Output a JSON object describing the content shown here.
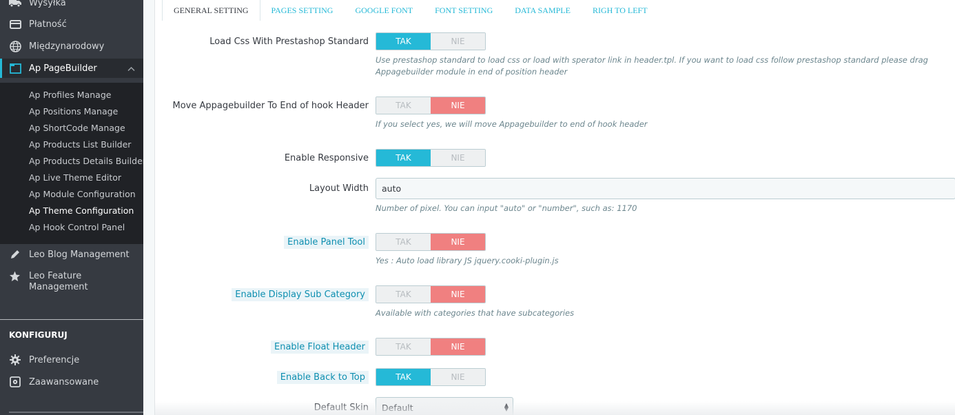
{
  "sidebar": {
    "top_items": [
      {
        "label": "Wysyłka",
        "icon": "truck-icon"
      },
      {
        "label": "Płatność",
        "icon": "credit-card-icon"
      },
      {
        "label": "Międzynarodowy",
        "icon": "globe-icon"
      }
    ],
    "active_item": {
      "label": "Ap PageBuilder",
      "icon": "browser-window-icon"
    },
    "sub_items": [
      {
        "label": "Ap Profiles Manage"
      },
      {
        "label": "Ap Positions Manage"
      },
      {
        "label": "Ap ShortCode Manage"
      },
      {
        "label": "Ap Products List Builder"
      },
      {
        "label": "Ap Products Details Builder"
      },
      {
        "label": "Ap Live Theme Editor"
      },
      {
        "label": "Ap Module Configuration"
      },
      {
        "label": "Ap Theme Configuration"
      },
      {
        "label": "Ap Hook Control Panel"
      }
    ],
    "leo_blog": {
      "label": "Leo Blog Management",
      "icon": "pencil-icon"
    },
    "leo_feature": {
      "line1": "Leo Feature",
      "line2": "Management",
      "icon": "star-icon"
    },
    "section_title": "KONFIGURUJ",
    "config_items": [
      {
        "label": "Preferencje",
        "icon": "gear-icon"
      },
      {
        "label": "Zaawansowane",
        "icon": "advanced-settings-icon"
      }
    ]
  },
  "tabs": [
    {
      "label": "GENERAL SETTING",
      "active": true
    },
    {
      "label": "PAGES SETTING"
    },
    {
      "label": "GOOGLE FONT"
    },
    {
      "label": "FONT SETTING"
    },
    {
      "label": "DATA SAMPLE"
    },
    {
      "label": "RIGH TO LEFT"
    }
  ],
  "switch_labels": {
    "yes": "TAK",
    "no": "NIE"
  },
  "form": {
    "load_css": {
      "label": "Load Css With Prestashop Standard",
      "value": "TAK",
      "help": "Use prestashop standard to load css or load with sperator link in header.tpl. If you want to load css follow prestashop standard please drag Appagebuilder module in end of position header"
    },
    "move_header": {
      "label": "Move Appagebuilder To End of hook Header",
      "value": "NIE",
      "help": "If you select yes, we will move Appagebuilder to end of hook header"
    },
    "responsive": {
      "label": "Enable Responsive",
      "value": "TAK"
    },
    "layout_width": {
      "label": "Layout Width",
      "value": "auto",
      "help": "Number of pixel. You can input \"auto\" or \"number\", such as: 1170"
    },
    "panel_tool": {
      "label": "Enable Panel Tool",
      "value": "NIE",
      "help": "Yes : Auto load library JS jquery.cooki-plugin.js"
    },
    "sub_category": {
      "label": "Enable Display Sub Category",
      "value": "NIE",
      "help": "Available with categories that have subcategories"
    },
    "float_header": {
      "label": "Enable Float Header",
      "value": "NIE"
    },
    "back_to_top": {
      "label": "Enable Back to Top",
      "value": "TAK"
    },
    "default_skin": {
      "label": "Default Skin",
      "value": "Default"
    }
  },
  "colors": {
    "accent": "#25b9d7",
    "no_active": "#f08080",
    "sidebar_bg": "#363a41"
  }
}
